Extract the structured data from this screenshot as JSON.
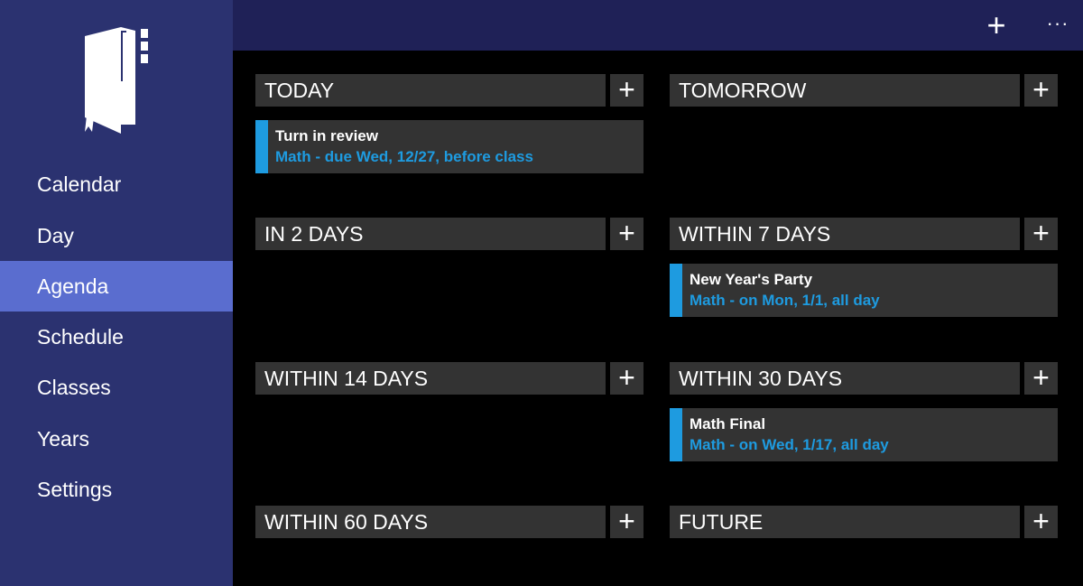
{
  "sidebar": {
    "items": [
      {
        "label": "Calendar",
        "active": false
      },
      {
        "label": "Day",
        "active": false
      },
      {
        "label": "Agenda",
        "active": true
      },
      {
        "label": "Schedule",
        "active": false
      },
      {
        "label": "Classes",
        "active": false
      },
      {
        "label": "Years",
        "active": false
      },
      {
        "label": "Settings",
        "active": false
      }
    ],
    "logo_icon": "notebook-pen-icon"
  },
  "topbar": {
    "add_label": "+",
    "more_label": "···"
  },
  "colors": {
    "sidebar_bg": "#2b3270",
    "sidebar_active": "#5a6dcf",
    "topbar_bg": "#1f2157",
    "accent": "#1e9be0"
  },
  "sections": [
    {
      "label": "TODAY",
      "items": [
        {
          "title": "Turn in review",
          "subtitle": "Math - due Wed, 12/27, before class"
        }
      ]
    },
    {
      "label": "TOMORROW",
      "items": []
    },
    {
      "label": "IN 2 DAYS",
      "items": []
    },
    {
      "label": "WITHIN 7 DAYS",
      "items": [
        {
          "title": "New Year's Party",
          "subtitle": "Math - on Mon, 1/1, all day"
        }
      ]
    },
    {
      "label": "WITHIN 14 DAYS",
      "items": []
    },
    {
      "label": "WITHIN 30 DAYS",
      "items": [
        {
          "title": "Math Final",
          "subtitle": "Math - on Wed, 1/17, all day"
        }
      ]
    },
    {
      "label": "WITHIN 60 DAYS",
      "items": []
    },
    {
      "label": "FUTURE",
      "items": []
    }
  ],
  "add_section_label": "+"
}
